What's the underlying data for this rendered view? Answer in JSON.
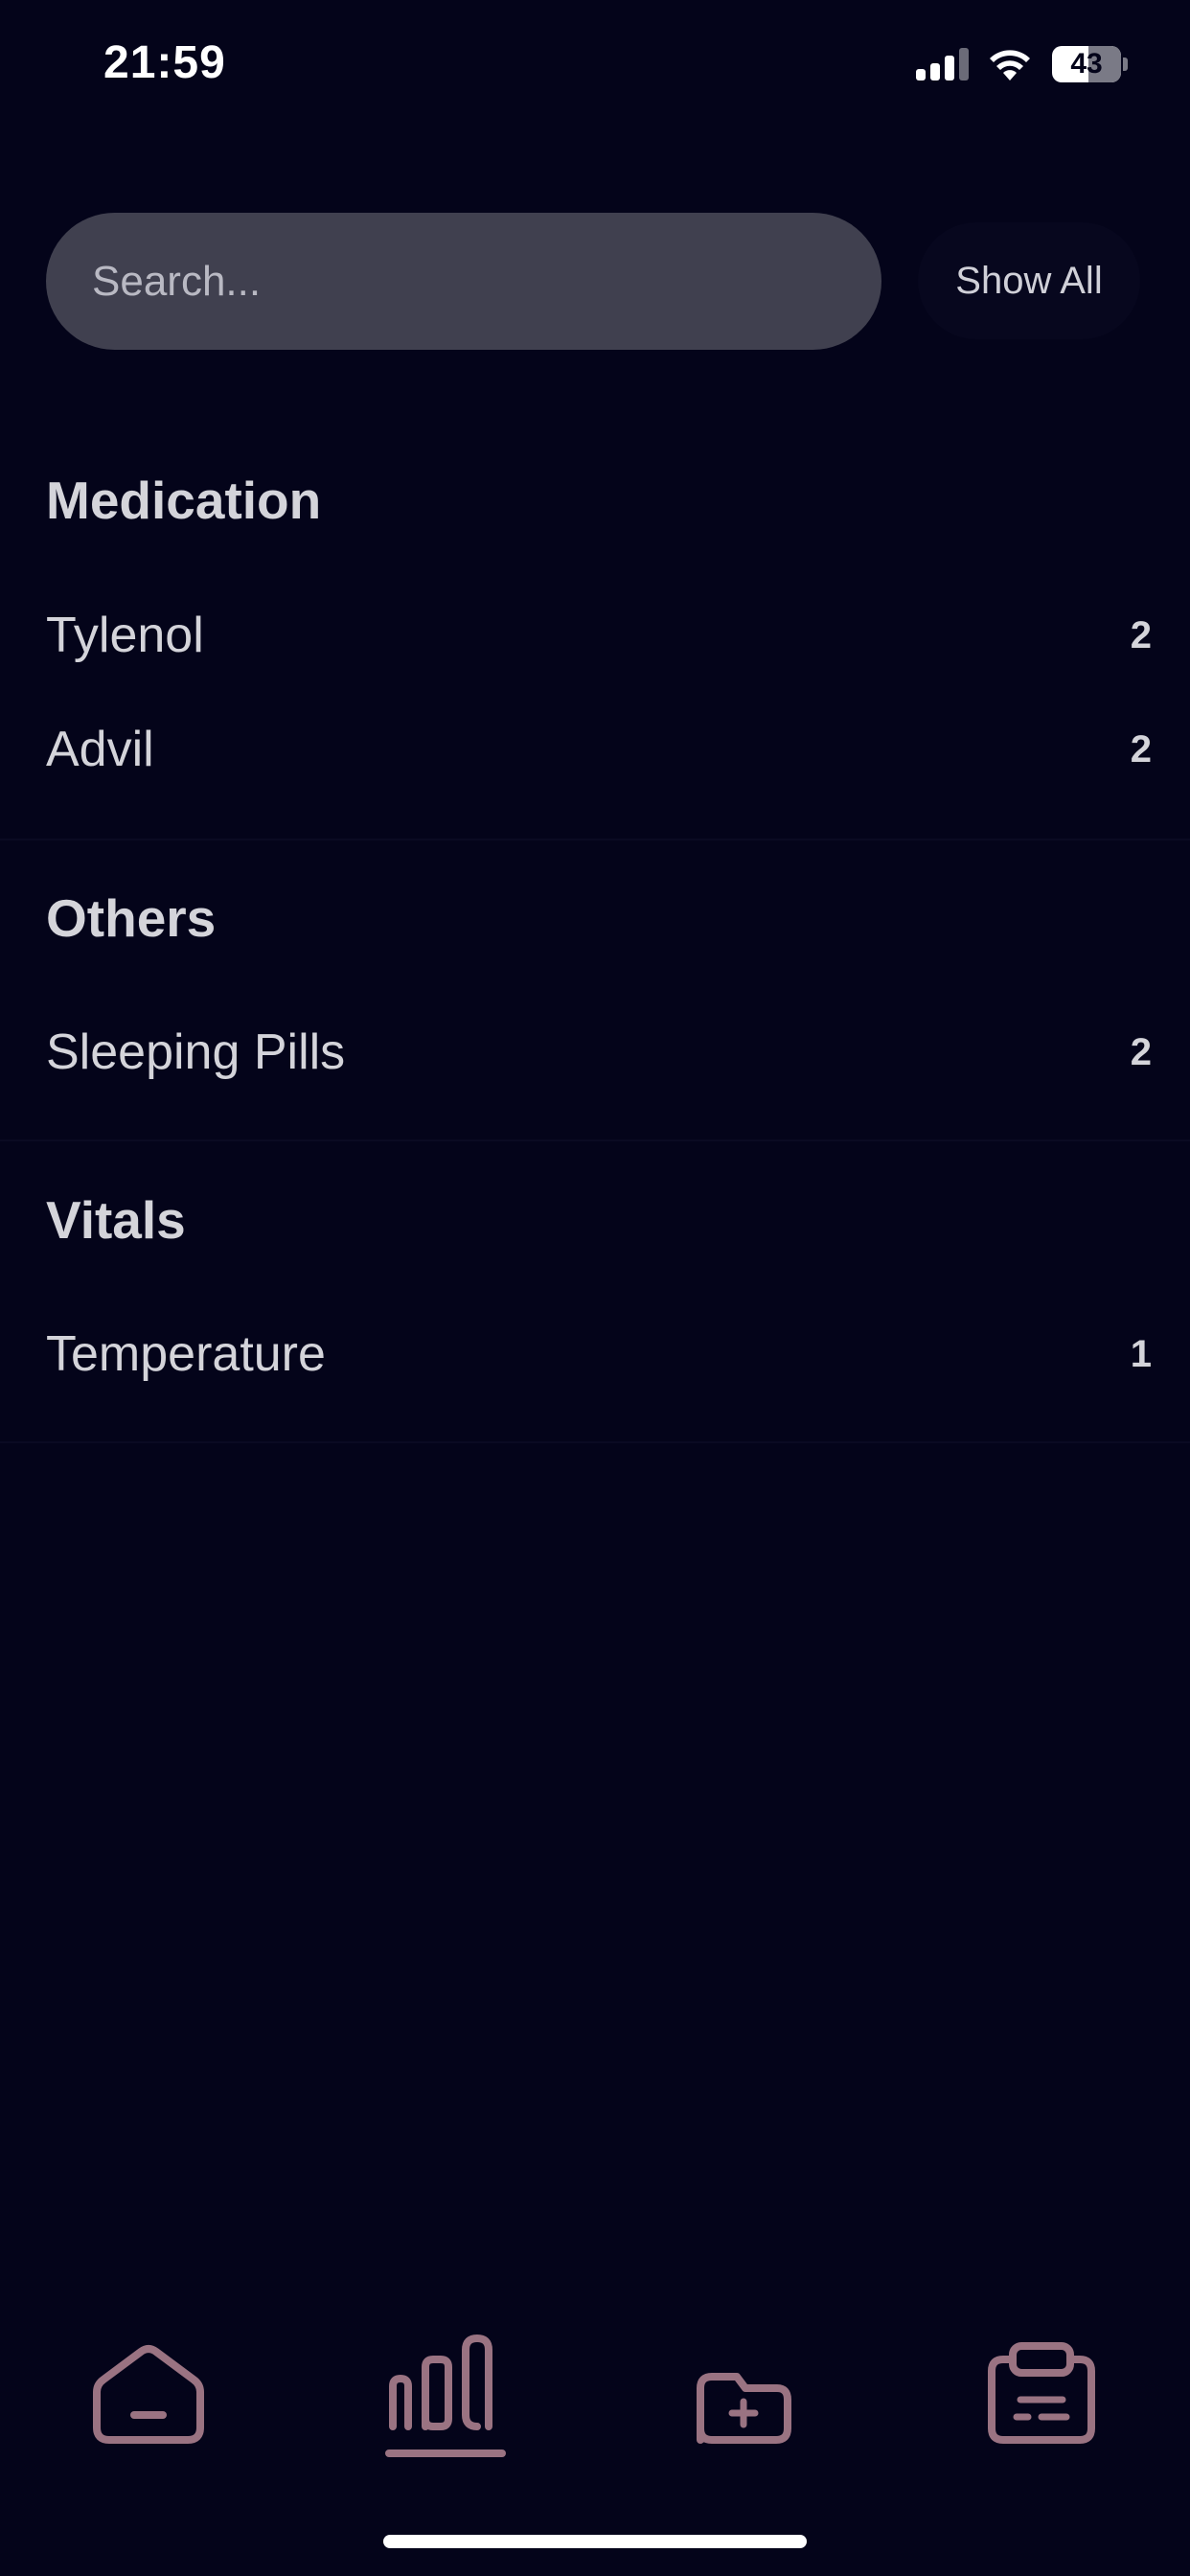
{
  "status_bar": {
    "time": "21:59",
    "battery_level": "43",
    "icons": [
      "signal-icon",
      "wifi-icon",
      "battery-icon"
    ]
  },
  "search": {
    "placeholder": "Search...",
    "value": "",
    "show_all_label": "Show All"
  },
  "sections": [
    {
      "title": "Medication",
      "items": [
        {
          "label": "Tylenol",
          "count": "2"
        },
        {
          "label": "Advil",
          "count": "2"
        }
      ]
    },
    {
      "title": "Others",
      "items": [
        {
          "label": "Sleeping Pills",
          "count": "2"
        }
      ]
    },
    {
      "title": "Vitals",
      "items": [
        {
          "label": "Temperature",
          "count": "1"
        }
      ]
    }
  ],
  "tab_bar": {
    "tabs": [
      {
        "icon": "home-icon",
        "selected": false
      },
      {
        "icon": "stats-icon",
        "selected": true
      },
      {
        "icon": "folder-add-icon",
        "selected": false
      },
      {
        "icon": "clipboard-icon",
        "selected": false
      }
    ],
    "icon_color": "#9a7382"
  },
  "colors": {
    "background": "#04041a",
    "search_field": "#40404f",
    "text": "#d4d4da"
  }
}
